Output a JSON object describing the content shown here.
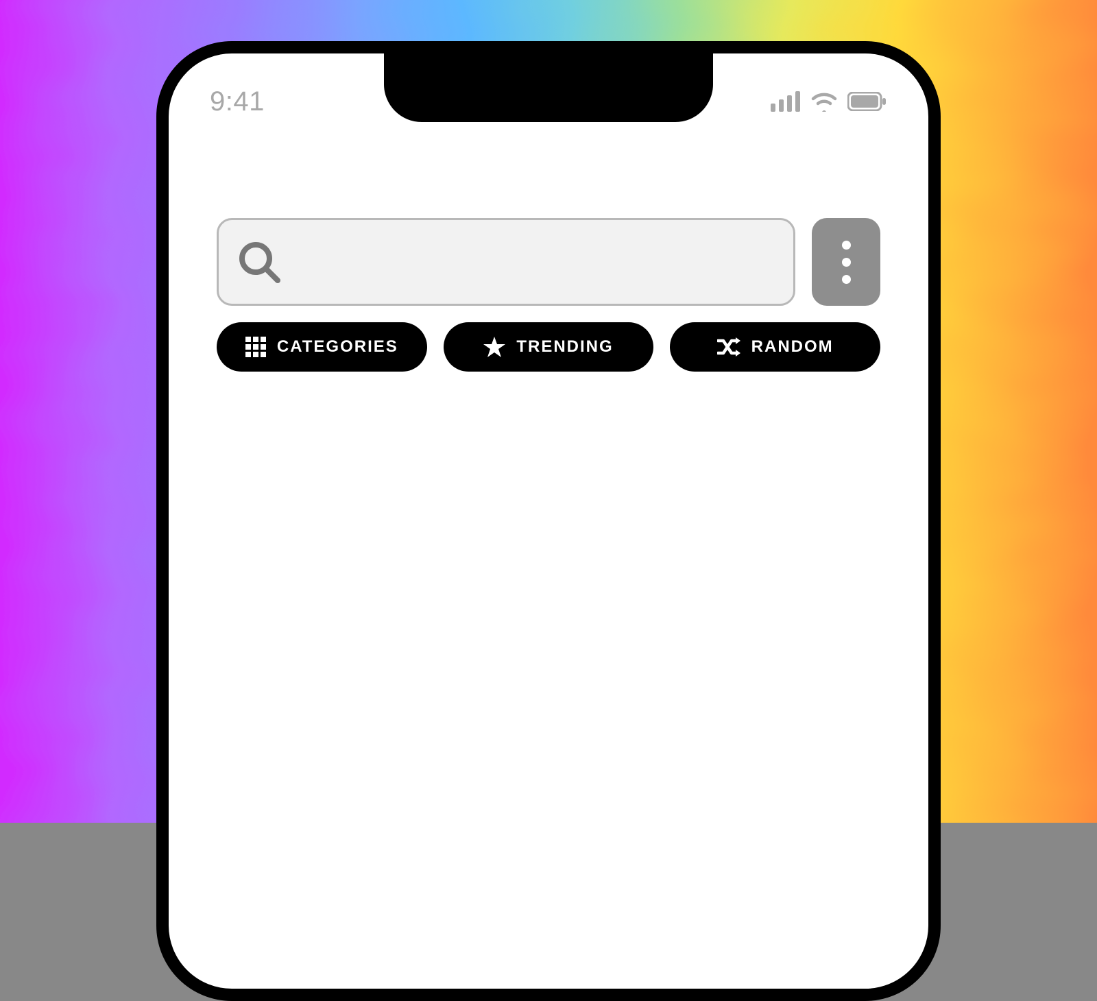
{
  "status": {
    "time": "9:41"
  },
  "filters": {
    "categories": "CATEGORIES",
    "trending": "TRENDING",
    "random": "RANDOM"
  }
}
